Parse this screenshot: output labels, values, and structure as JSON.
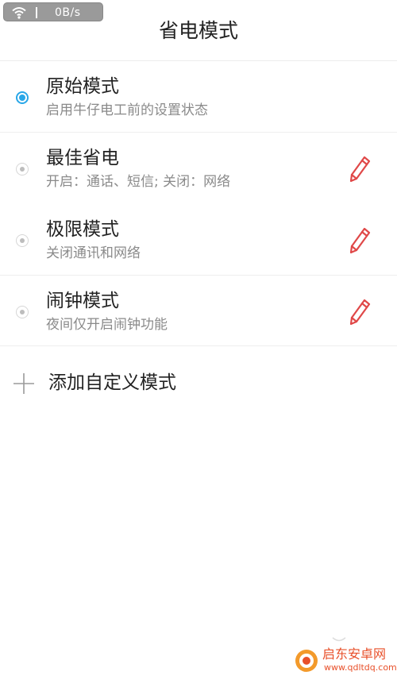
{
  "status_bar": {
    "wifi_icon": "wifi-icon",
    "net_speed": "0B/s"
  },
  "header": {
    "title": "省电模式"
  },
  "modes": [
    {
      "title": "原始模式",
      "description": "启用牛仔电工前的设置状态",
      "selected": true,
      "editable": false
    },
    {
      "title": "最佳省电",
      "description": "开启：通话、短信; 关闭：网络",
      "selected": false,
      "editable": true
    },
    {
      "title": "极限模式",
      "description": "关闭通讯和网络",
      "selected": false,
      "editable": true
    },
    {
      "title": "闹钟模式",
      "description": "夜间仅开启闹钟功能",
      "selected": false,
      "editable": true
    }
  ],
  "add_custom": {
    "label": "添加自定义模式"
  },
  "watermark": {
    "name": "启东安卓网",
    "url": "www.qdltdq.com"
  },
  "colors": {
    "accent": "#29a7e8",
    "edit_icon": "#e04848",
    "watermark": "#e8502a"
  }
}
